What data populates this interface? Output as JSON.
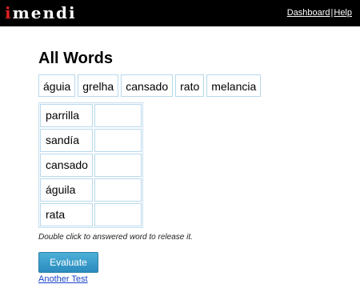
{
  "header": {
    "logo_accent": "i",
    "logo_rest": "mendi",
    "nav": {
      "dashboard": "Dashboard",
      "separator": "|",
      "help": "Help"
    }
  },
  "main": {
    "title": "All Words",
    "word_bank": [
      "águia",
      "grelha",
      "cansado",
      "rato",
      "melancia"
    ],
    "match_rows": [
      {
        "prompt": "parrilla",
        "answer": ""
      },
      {
        "prompt": "sandía",
        "answer": ""
      },
      {
        "prompt": "cansado",
        "answer": ""
      },
      {
        "prompt": "águila",
        "answer": ""
      },
      {
        "prompt": "rata",
        "answer": ""
      }
    ],
    "hint": "Double click to answered word to release it.",
    "evaluate_label": "Evaluate",
    "another_test_label": "Another Test"
  },
  "colors": {
    "topbar": "#000000",
    "logo_accent": "#e02020",
    "cell_border": "#b8d8ec",
    "button": "#2a8bbd",
    "link": "#1a44cc"
  }
}
